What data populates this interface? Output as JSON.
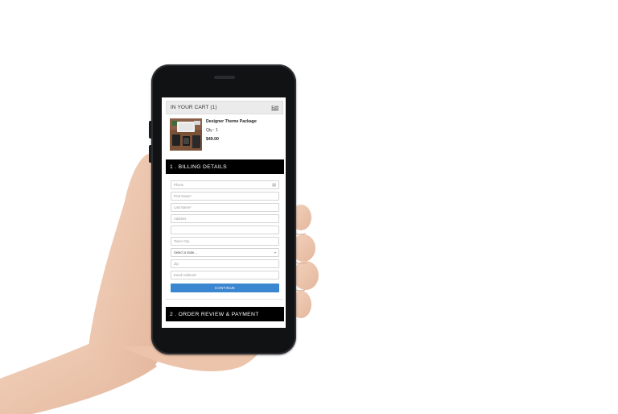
{
  "cart": {
    "title": "IN YOUR CART (1)",
    "edit_label": "Edit",
    "item": {
      "name": "Designer Theme Package",
      "qty": "Qty : 1",
      "price": "$49.00"
    }
  },
  "sections": {
    "billing": "1 . BILLING DETAILS",
    "review": "2 . ORDER REVIEW & PAYMENT"
  },
  "form": {
    "phone": "Phone",
    "first_name": "First Name*",
    "last_name": "Last Name*",
    "address": "Address",
    "address2": "",
    "town_city": "Town/ City",
    "state": "Select a state...",
    "zip": "Zip",
    "email": "Email Address*",
    "continue_label": "CONTINUE"
  },
  "colors": {
    "accent": "#3b86d0",
    "section_bar": "#000000",
    "cart_header_bg": "#ebebeb"
  }
}
